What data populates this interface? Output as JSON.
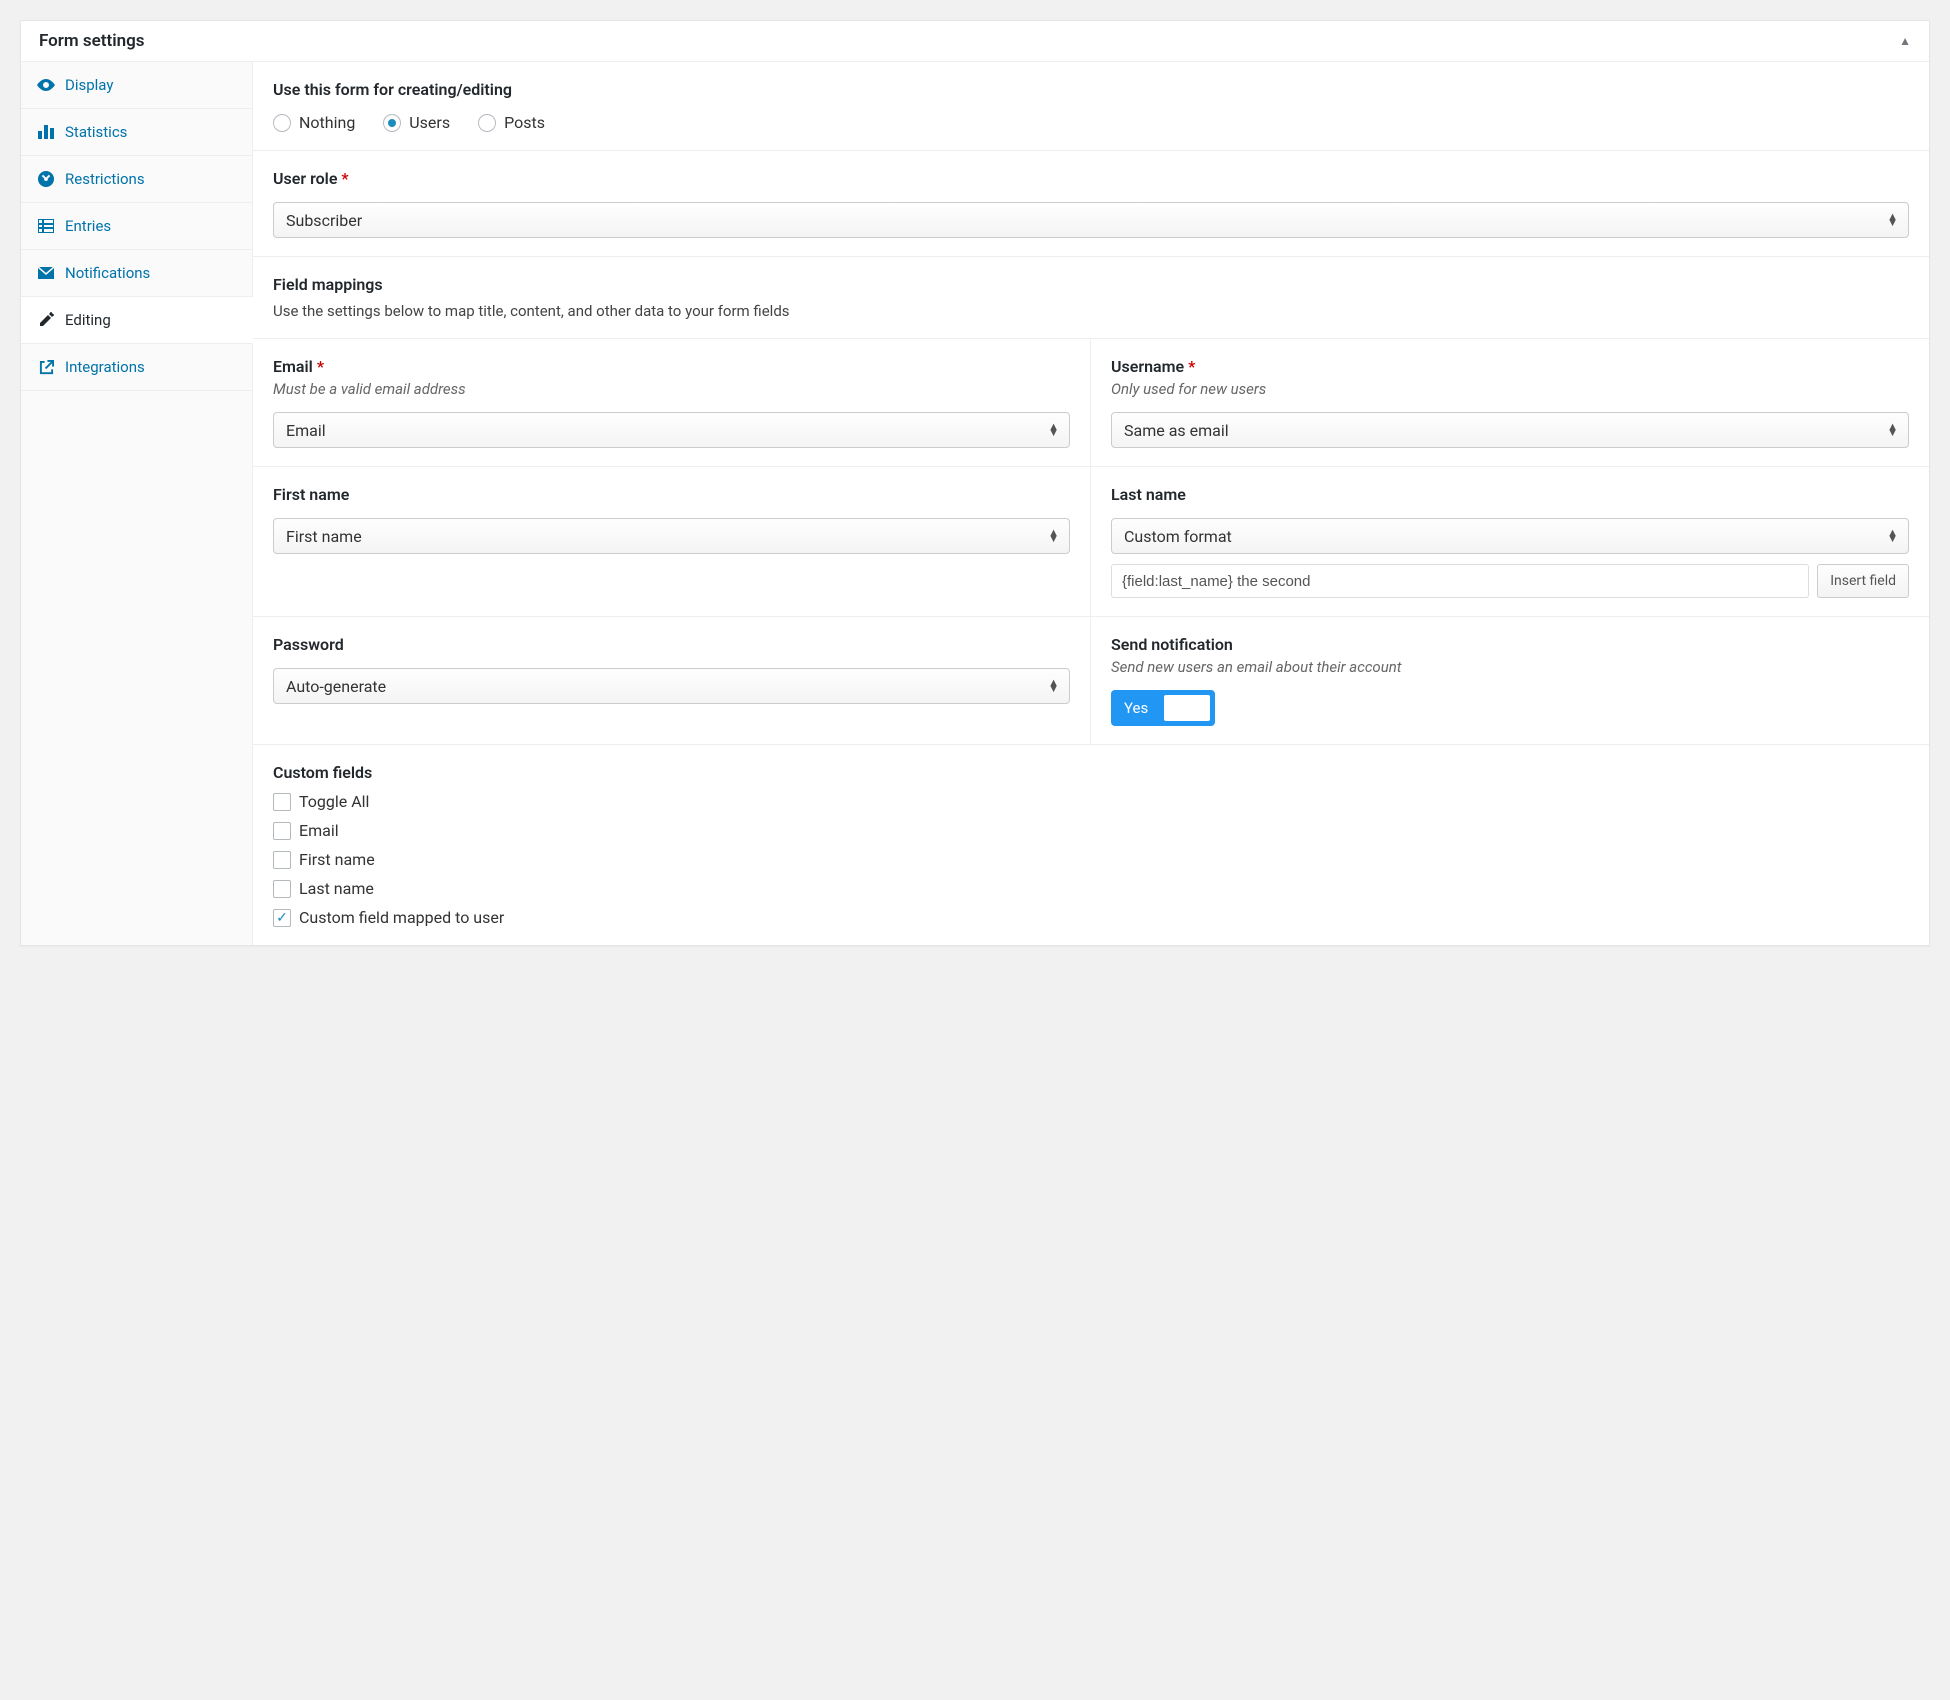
{
  "panel": {
    "title": "Form settings"
  },
  "sidebar": {
    "items": [
      {
        "label": "Display"
      },
      {
        "label": "Statistics"
      },
      {
        "label": "Restrictions"
      },
      {
        "label": "Entries"
      },
      {
        "label": "Notifications"
      },
      {
        "label": "Editing"
      },
      {
        "label": "Integrations"
      }
    ]
  },
  "usefor": {
    "title": "Use this form for creating/editing",
    "options": {
      "nothing": "Nothing",
      "users": "Users",
      "posts": "Posts"
    }
  },
  "userrole": {
    "title": "User role",
    "value": "Subscriber"
  },
  "fieldmappings": {
    "title": "Field mappings",
    "desc": "Use the settings below to map title, content, and other data to your form fields"
  },
  "email": {
    "title": "Email",
    "hint": "Must be a valid email address",
    "value": "Email"
  },
  "username": {
    "title": "Username",
    "hint": "Only used for new users",
    "value": "Same as email"
  },
  "firstname": {
    "title": "First name",
    "value": "First name"
  },
  "lastname": {
    "title": "Last name",
    "value": "Custom format",
    "custom": "{field:last_name} the second",
    "insert_btn": "Insert field"
  },
  "password": {
    "title": "Password",
    "value": "Auto-generate"
  },
  "notification": {
    "title": "Send notification",
    "hint": "Send new users an email about their account",
    "toggle": "Yes"
  },
  "customfields": {
    "title": "Custom fields",
    "items": [
      {
        "label": "Toggle All",
        "checked": false
      },
      {
        "label": "Email",
        "checked": false
      },
      {
        "label": "First name",
        "checked": false
      },
      {
        "label": "Last name",
        "checked": false
      },
      {
        "label": "Custom field mapped to user",
        "checked": true
      }
    ]
  }
}
